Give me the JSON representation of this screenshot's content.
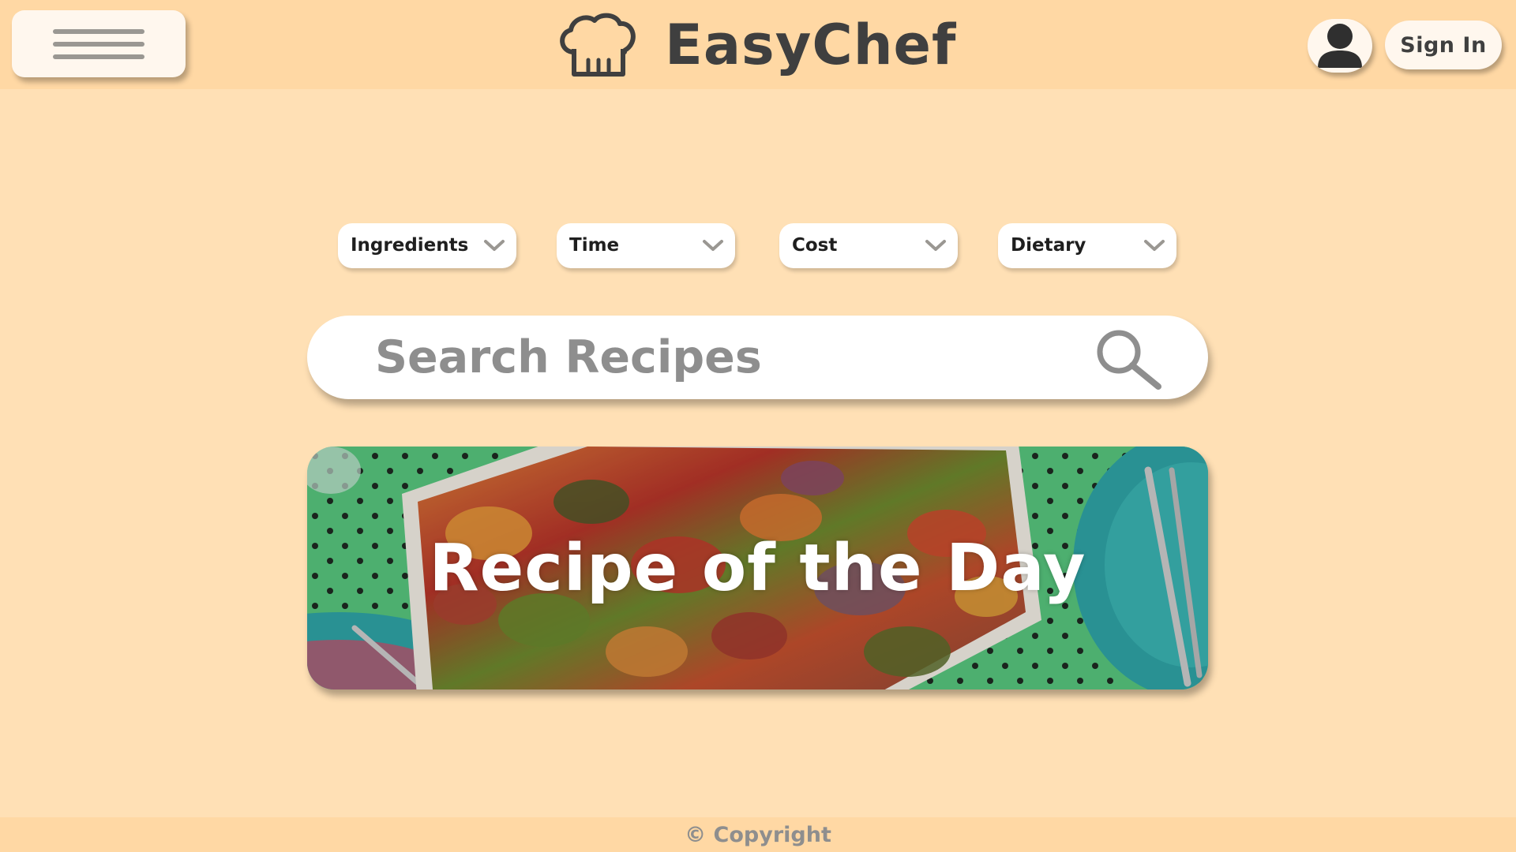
{
  "app": {
    "name": "EasyChef",
    "logo_icon": "chef-hat-icon"
  },
  "header": {
    "menu_icon": "hamburger-menu-icon",
    "profile_icon": "user-avatar-icon",
    "sign_in_label": "Sign In"
  },
  "filters": [
    {
      "label": "Ingredients",
      "icon": "chevron-down-icon"
    },
    {
      "label": "Time",
      "icon": "chevron-down-icon"
    },
    {
      "label": "Cost",
      "icon": "chevron-down-icon"
    },
    {
      "label": "Dietary",
      "icon": "chevron-down-icon"
    }
  ],
  "search": {
    "placeholder": "Search Recipes",
    "icon": "search-icon"
  },
  "featured": {
    "title": "Recipe of the Day"
  },
  "footer": {
    "copyright": "© Copyright"
  },
  "colors": {
    "background": "#FFE0B5",
    "header": "#FFD8A4",
    "text_dark": "#3F3F3F",
    "text_muted": "#8E8E8E"
  }
}
